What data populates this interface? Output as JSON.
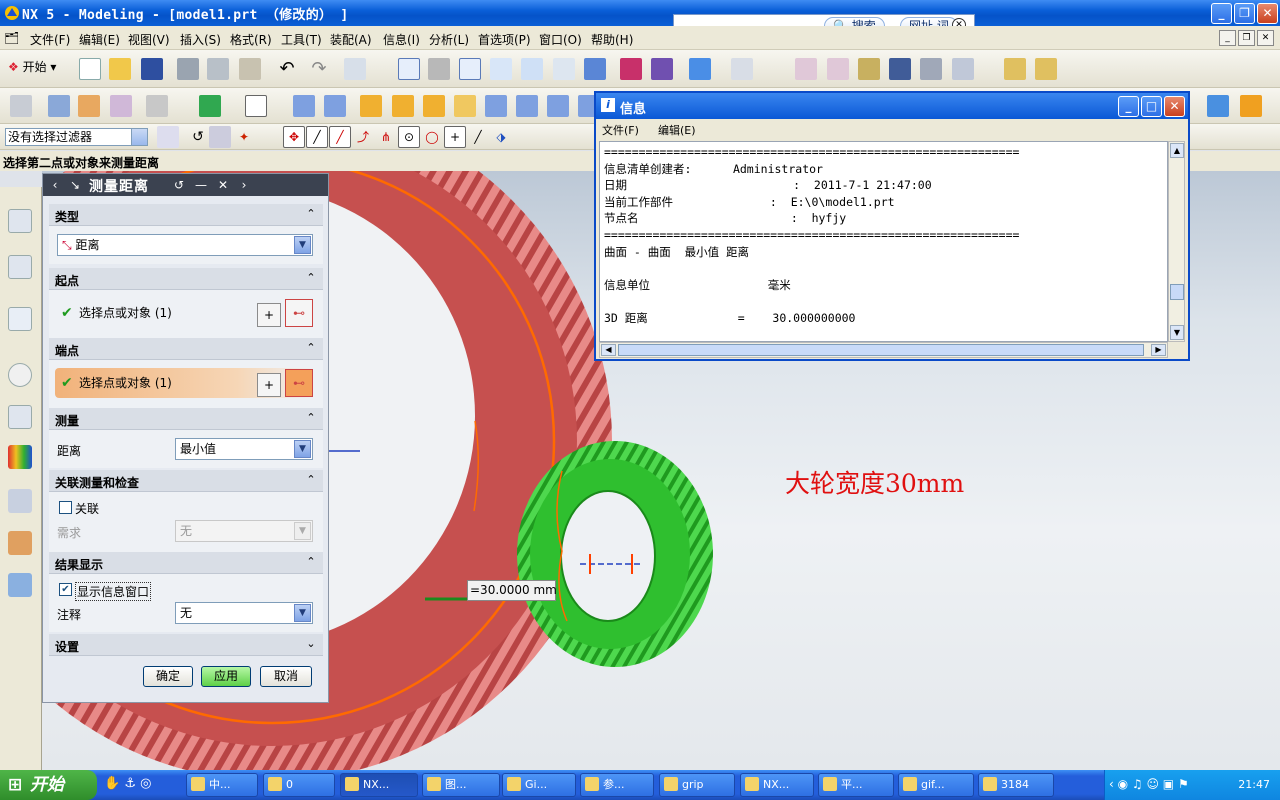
{
  "window": {
    "title": "NX 5 - Modeling - [model1.prt （修改的） ]",
    "buttons": [
      "minimize",
      "restore",
      "close"
    ]
  },
  "search_popup": {
    "search_label": "搜索",
    "url_label": "网址 词"
  },
  "menubar": {
    "items": [
      "文件(F)",
      "编辑(E)",
      "视图(V)",
      "插入(S)",
      "格式(R)",
      "工具(T)",
      "装配(A)",
      "信息(I)",
      "分析(L)",
      "首选项(P)",
      "窗口(O)",
      "帮助(H)"
    ]
  },
  "toolbar": {
    "start_label": "开始"
  },
  "selection_bar": {
    "filter_value": "没有选择过滤器"
  },
  "cue_line": "选择第二点或对象来测量距离",
  "annotation": "大轮宽度30mm",
  "dimension_label": "=30.0000 mm",
  "dialog": {
    "title": "测量距离",
    "groups": {
      "type": {
        "label": "类型",
        "value": "距离"
      },
      "start": {
        "label": "起点",
        "selection": "选择点或对象 (1)"
      },
      "end": {
        "label": "端点",
        "selection": "选择点或对象 (1)"
      },
      "measure": {
        "label": "测量",
        "field_label": "距离",
        "value": "最小值"
      },
      "associative": {
        "label": "关联测量和检查",
        "checkbox_label": "关联",
        "requirement_label": "需求",
        "requirement_value": "无"
      },
      "results": {
        "label": "结果显示",
        "checkbox_label": "显示信息窗口",
        "note_label": "注释",
        "note_value": "无"
      },
      "settings": {
        "label": "设置"
      }
    },
    "buttons": {
      "ok": "确定",
      "apply": "应用",
      "cancel": "取消"
    }
  },
  "info_window": {
    "title": "信息",
    "menu": [
      "文件(F)",
      "编辑(E)"
    ],
    "lines": [
      "============================================================",
      "信息清单创建者:      Administrator",
      "日期                        :  2011-7-1 21:47:00",
      "当前工作部件              :  E:\\0\\model1.prt",
      "节点名                      :  hyfjy",
      "============================================================",
      "曲面 - 曲面  最小值 距离",
      "",
      "信息单位                 毫米",
      "",
      "3D 距离             =    30.000000000"
    ]
  },
  "taskbar": {
    "start_label": "开始",
    "tasks": [
      "中...",
      "0",
      "NX...",
      "图...",
      "Gi...",
      "参...",
      "grip",
      "NX...",
      "平...",
      "gif...",
      "3184"
    ],
    "clock": "21:47"
  },
  "colors": {
    "xp_blue": "#0a58d6",
    "gear_large": "#c6504f",
    "gear_small": "#2fbf2f",
    "annotation_red": "#e01010"
  }
}
